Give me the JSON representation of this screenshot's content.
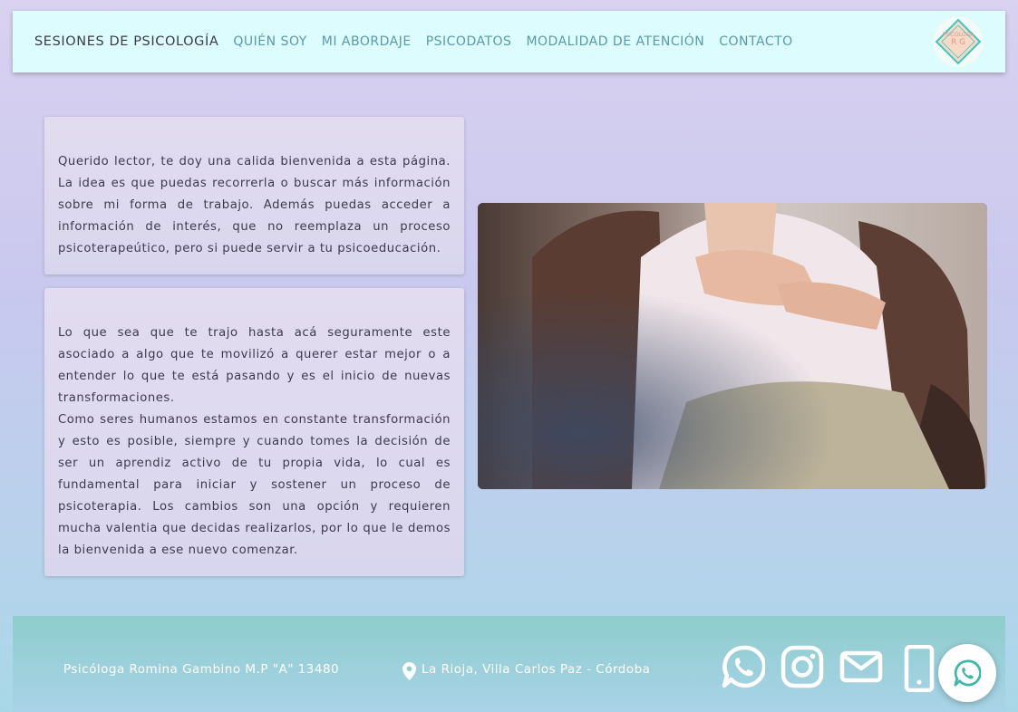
{
  "navbar": {
    "brand": "SESIONES DE PSICOLOGÍA",
    "links": [
      "QUIÉN SOY",
      "MI ABORDAJE",
      "PSICODATOS",
      "MODALIDAD DE ATENCIÓN",
      "CONTACTO"
    ],
    "logo_text_line1": "PSICÓLOGA",
    "logo_text_line2": "R G",
    "logo_icon": "diamond-logo-icon"
  },
  "intro": {
    "card1_text": "Querido lector, te doy una calida bienvenida a esta página. La idea es que puedas recorrerla o buscar más información sobre mi forma de trabajo. Además puedas acceder a información de interés, que no reemplaza un proceso psicoterapeútico, pero si puede servir a tu psicoeducación.",
    "card2_paragraph1": "Lo que sea que te trajo hasta acá seguramente este asociado a algo que te movilizó a querer estar mejor o a entender lo que te está pasando y es el inicio de nuevas transformaciones.",
    "card2_paragraph2": "Como seres humanos estamos en constante transformación y esto es posible, siempre y cuando tomes la decisión de ser un aprendiz activo de tu propia vida, lo cual es fundamental para iniciar y sostener un proceso de psicoterapia. Los cambios son una opción y requieren mucha valentia que decidas realizarlos, por lo que le demos la bienvenida a ese nuevo comenzar."
  },
  "footer": {
    "name": "Psicóloga Romina Gambino M.P \"A\" 13480",
    "location": "La Rioja, Villa Carlos Paz - Córdoba",
    "icons": [
      "location-pin-icon",
      "whatsapp-icon",
      "instagram-icon",
      "mail-icon",
      "phone-icon"
    ]
  },
  "floating_button_icon": "whatsapp-icon",
  "colors": {
    "navbar_bg": "#ddfcfd",
    "nav_link": "#5a9aa8",
    "footer_bg": "#8ecdcc",
    "logo_accent": "#3fc7c0"
  }
}
